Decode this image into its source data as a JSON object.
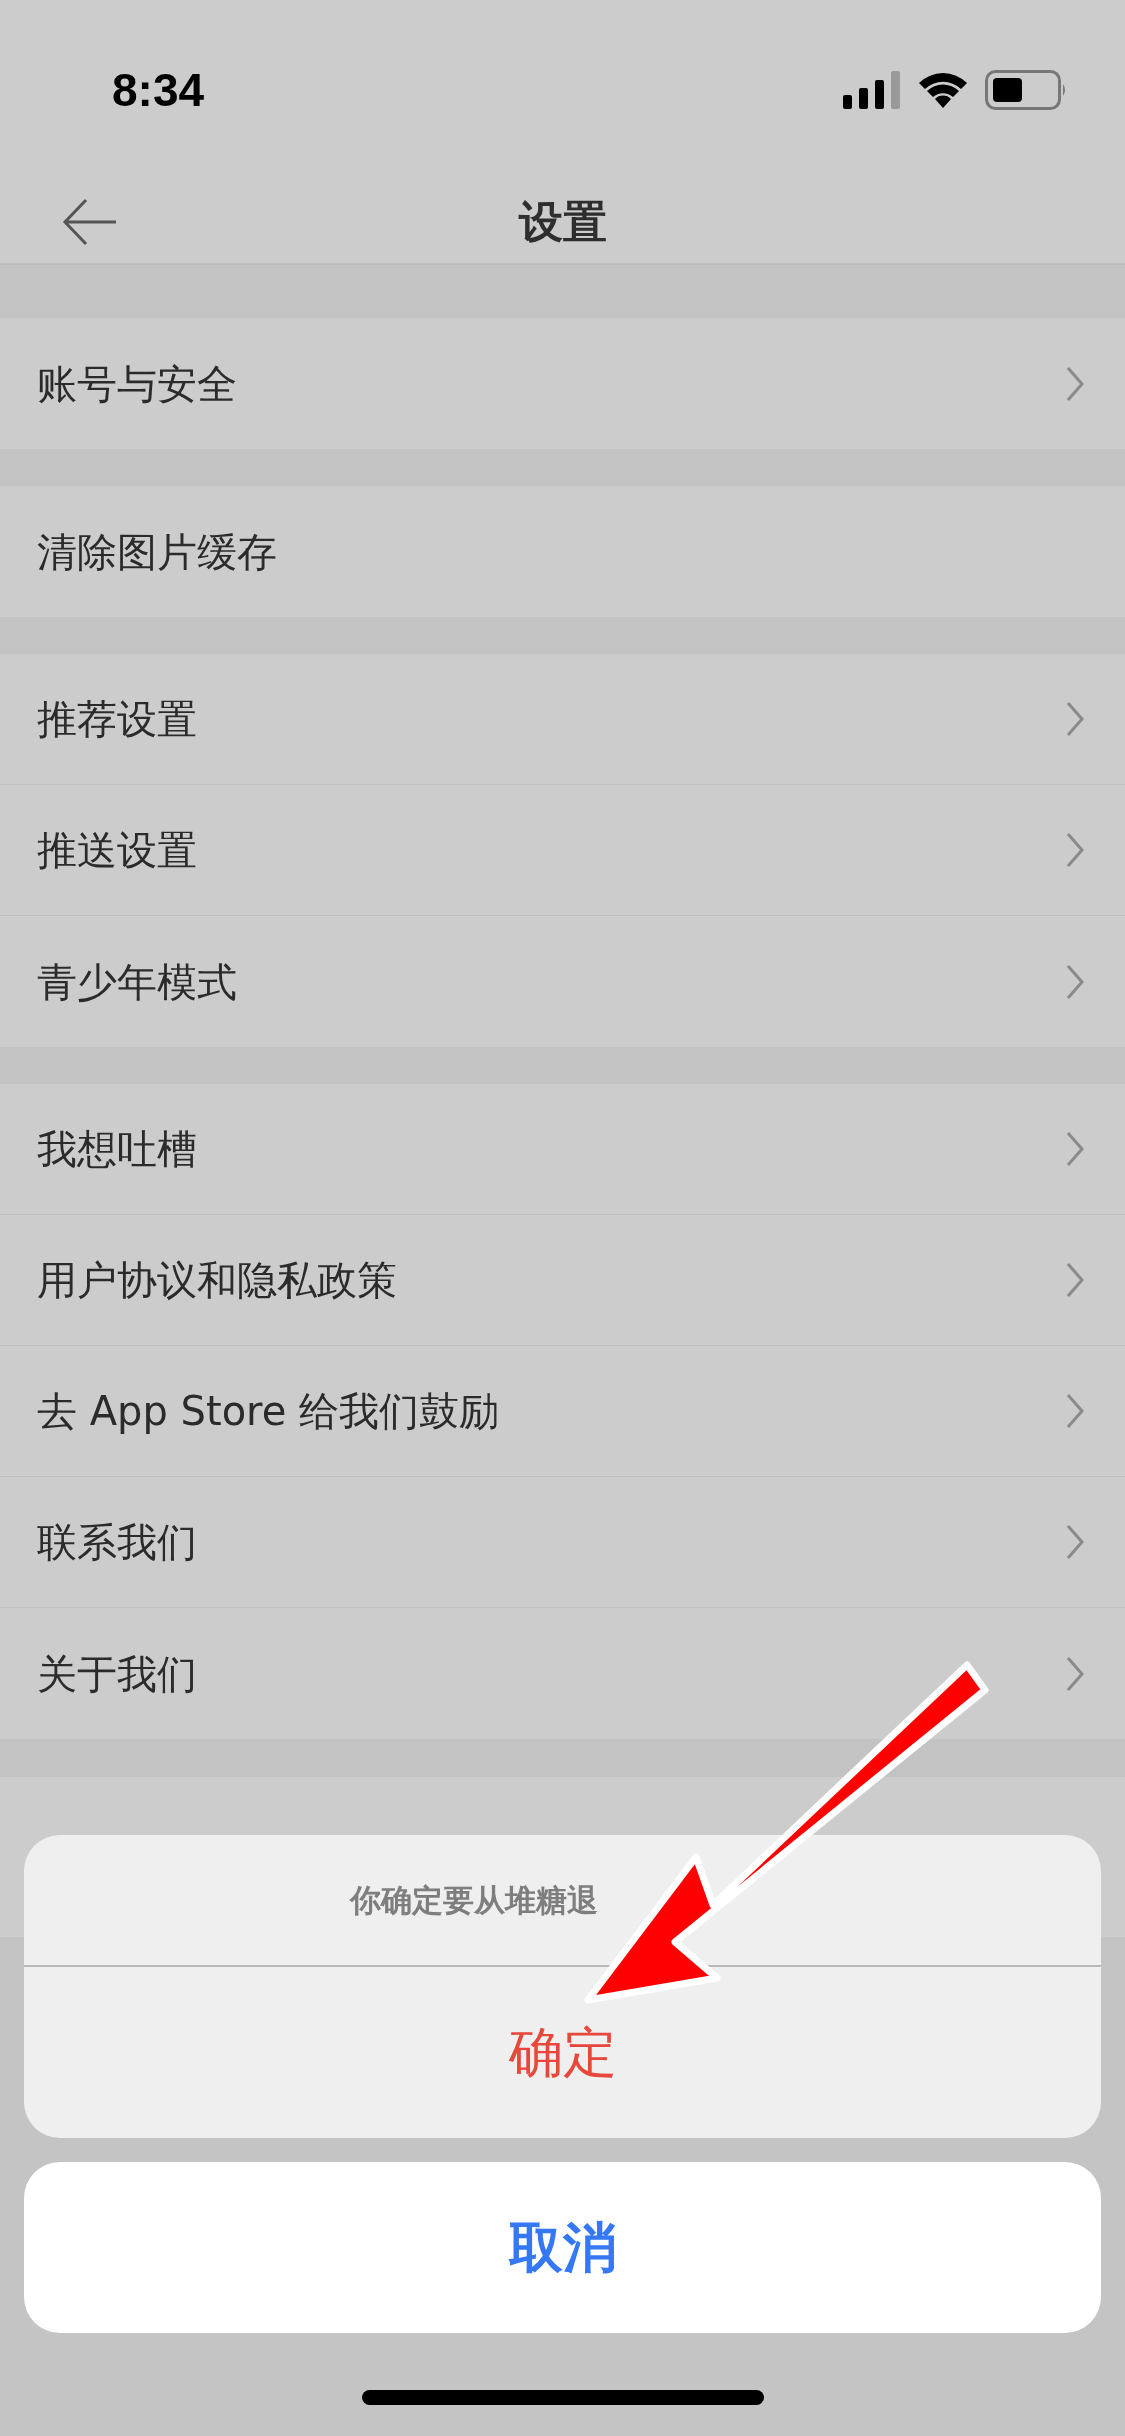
{
  "status_bar": {
    "time": "8:34"
  },
  "nav": {
    "title": "设置"
  },
  "groups": [
    {
      "items": [
        {
          "label": "账号与安全",
          "chevron": true
        }
      ]
    },
    {
      "items": [
        {
          "label": "清除图片缓存",
          "chevron": false
        }
      ]
    },
    {
      "items": [
        {
          "label": "推荐设置",
          "chevron": true
        },
        {
          "label": "推送设置",
          "chevron": true
        },
        {
          "label": "青少年模式",
          "chevron": true
        }
      ]
    },
    {
      "items": [
        {
          "label": "我想吐槽",
          "chevron": true
        },
        {
          "label": "用户协议和隐私政策",
          "chevron": true
        },
        {
          "label": "去 App Store 给我们鼓励",
          "chevron": true
        },
        {
          "label": "联系我们",
          "chevron": true
        },
        {
          "label": "关于我们",
          "chevron": true
        }
      ]
    }
  ],
  "action_sheet": {
    "message": "你确定要从堆糖退",
    "confirm": "确定",
    "cancel": "取消"
  }
}
